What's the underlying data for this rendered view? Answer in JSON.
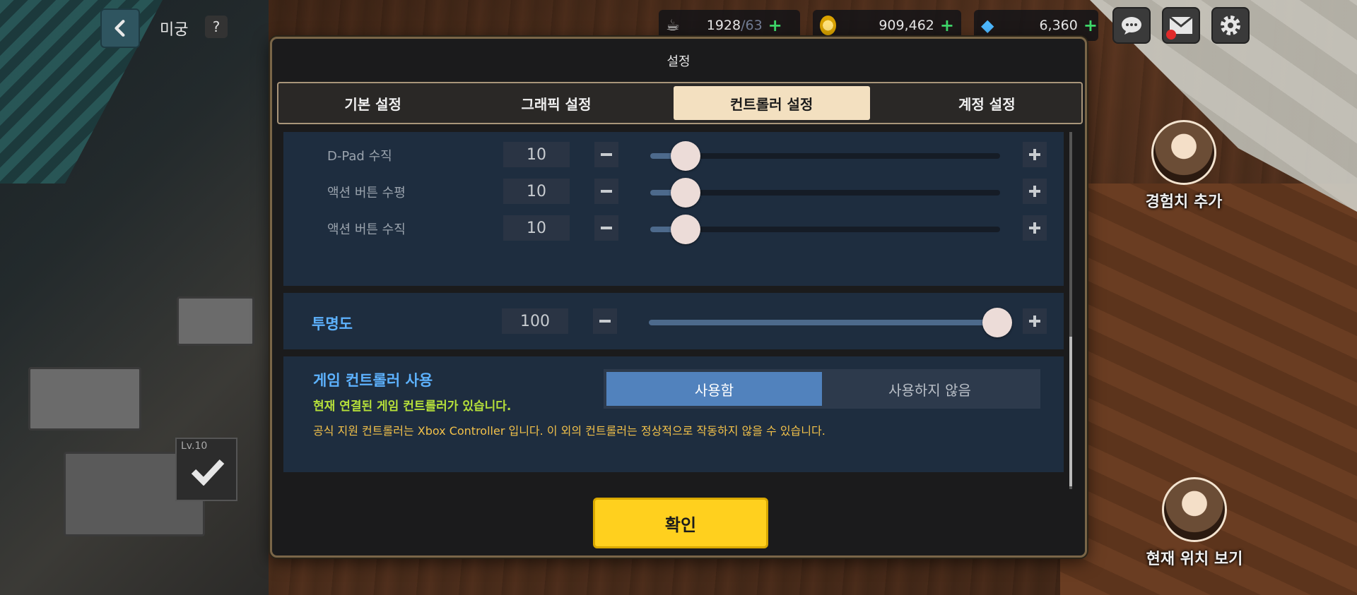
{
  "hud": {
    "location": "미궁",
    "help": "?",
    "stamina": "1928",
    "stamina_max": "/63",
    "gold": "909,462",
    "gems": "6,360",
    "plus": "+"
  },
  "side": {
    "exp_bonus": "경험치 추가",
    "current_location": "현재 위치 보기",
    "level": "Lv.10"
  },
  "modal": {
    "title": "설정",
    "tabs": [
      {
        "label": "기본 설정"
      },
      {
        "label": "그래픽 설정"
      },
      {
        "label": "컨트롤러 설정"
      },
      {
        "label": "계정 설정"
      }
    ],
    "active_tab": 2,
    "sliders": [
      {
        "label": "D-Pad 수직",
        "value": "10",
        "fraction": 0.1
      },
      {
        "label": "액션 버튼 수평",
        "value": "10",
        "fraction": 0.1
      },
      {
        "label": "액션 버튼 수직",
        "value": "10",
        "fraction": 0.1
      }
    ],
    "opacity": {
      "label": "투명도",
      "value": "100",
      "fraction": 1.0
    },
    "controller": {
      "title": "게임 컨트롤러 사용",
      "status": "현재 연결된 게임 컨트롤러가 있습니다.",
      "note": "공식 지원 컨트롤러는 Xbox Controller 입니다. 이 외의 컨트롤러는 정상적으로 작동하지 않을 수 있습니다.",
      "on_label": "사용함",
      "off_label": "사용하지 않음"
    },
    "confirm": "확인"
  },
  "colors": {
    "accent_blue": "#5db2ff",
    "status_green": "#b6e03a",
    "note_yellow": "#f2c14a",
    "confirm_yellow": "#ffd01e",
    "tab_active": "#f3e0c0"
  }
}
